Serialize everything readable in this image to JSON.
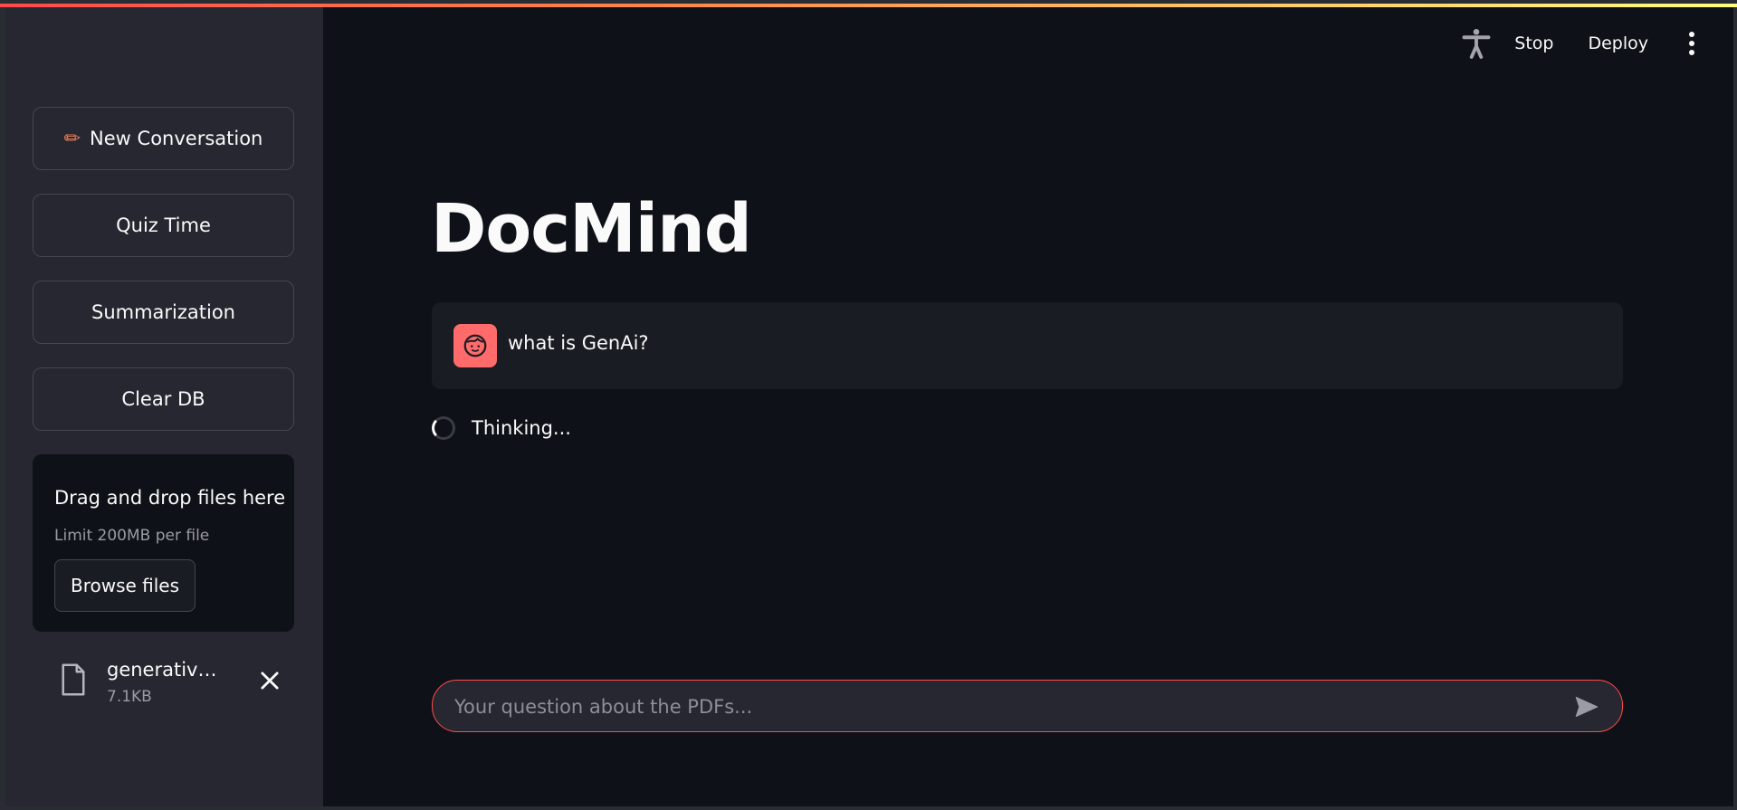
{
  "sidebar": {
    "buttons": {
      "new_conversation": "New Conversation",
      "quiz_time": "Quiz Time",
      "summarization": "Summarization",
      "clear_db": "Clear DB"
    },
    "uploader": {
      "title": "Drag and drop files here",
      "limit": "Limit 200MB per file",
      "browse_label": "Browse files"
    },
    "file": {
      "name": "generative…",
      "size": "7.1KB"
    }
  },
  "header": {
    "stop_label": "Stop",
    "deploy_label": "Deploy",
    "icons": [
      "accessibility-icon",
      "kebab-menu-icon"
    ]
  },
  "main": {
    "title": "DocMind",
    "messages": [
      {
        "role": "user",
        "text": "what is GenAi?"
      }
    ],
    "status": "Thinking...",
    "chat_input": {
      "placeholder": "Your question about the PDFs...",
      "value": ""
    }
  },
  "colors": {
    "background": "#0e1117",
    "sidebar": "#262730",
    "accent": "#ff4b4b",
    "avatar": "#ff6b6b"
  }
}
